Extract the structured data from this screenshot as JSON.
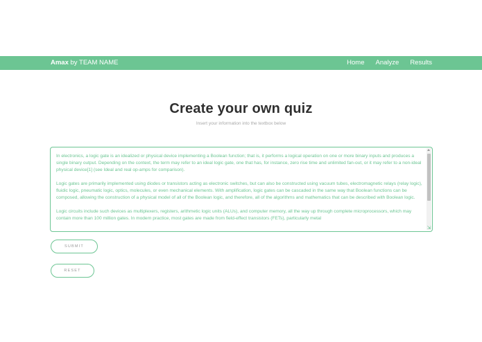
{
  "navbar": {
    "brand_bold": "Amax",
    "brand_rest": " by TEAM NAME",
    "links": [
      "Home",
      "Analyze",
      "Results"
    ]
  },
  "main": {
    "title": "Create your own quiz",
    "subtitle": "Insert your information into the textbox below",
    "textbox": {
      "paragraphs": [
        "In electronics, a logic gate is an idealized or physical device implementing a Boolean function; that is, it performs a logical operation on one or more binary inputs and produces a single binary output. Depending on the context, the term may refer to an ideal logic gate, one that has, for instance, zero rise time and unlimited fan-out, or it may refer to a non-ideal physical device[1] (see Ideal and real op-amps for comparison).",
        "Logic gates are primarily implemented using diodes or transistors acting as electronic switches, but can also be constructed using vacuum tubes, electromagnetic relays (relay logic), fluidic logic, pneumatic logic, optics, molecules, or even mechanical elements. With amplification, logic gates can be cascaded in the same way that Boolean functions can be composed, allowing the construction of a physical model of all of the Boolean logic, and therefore, all of the algorithms and mathematics that can be described with Boolean logic.",
        "Logic circuits include such devices as multiplexers, registers, arithmetic logic units (ALUs), and computer memory, all the way up through complete microprocessors, which may contain more than 100 million gates. In modern practice, most gates are made from field-effect transistors (FETs), particularly metal"
      ]
    },
    "submit_label": "SUBMIT",
    "reset_label": "RESET"
  },
  "colors": {
    "accent": "#6cc593",
    "title": "#2f2f2f",
    "muted": "#a8a8a8"
  }
}
